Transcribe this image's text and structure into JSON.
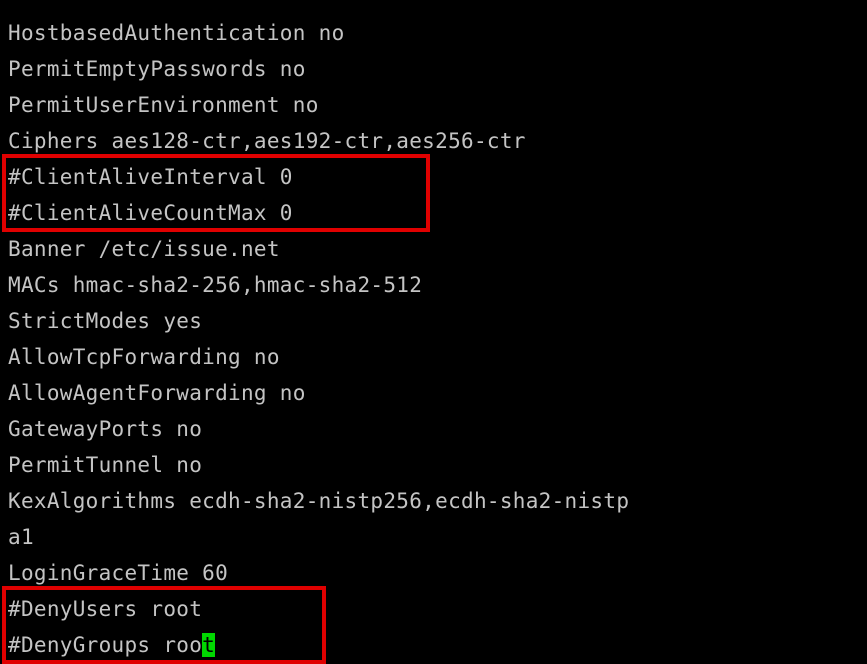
{
  "terminal": {
    "lines": [
      "HostbasedAuthentication no",
      "PermitEmptyPasswords no",
      "PermitUserEnvironment no",
      "Ciphers aes128-ctr,aes192-ctr,aes256-ctr",
      "#ClientAliveInterval 0",
      "#ClientAliveCountMax 0",
      "Banner /etc/issue.net",
      "MACs hmac-sha2-256,hmac-sha2-512",
      "StrictModes yes",
      "AllowTcpForwarding no",
      "AllowAgentForwarding no",
      "GatewayPorts no",
      "PermitTunnel no",
      "KexAlgorithms ecdh-sha2-nistp256,ecdh-sha2-nistp",
      "a1",
      "LoginGraceTime 60",
      "#DenyUsers root"
    ],
    "last_line_text": "#DenyGroups roo",
    "cursor_char": "t"
  },
  "colors": {
    "background": "#000000",
    "text": "#c4c4c4",
    "cursor": "#00d800",
    "highlight_border": "#e00000"
  }
}
